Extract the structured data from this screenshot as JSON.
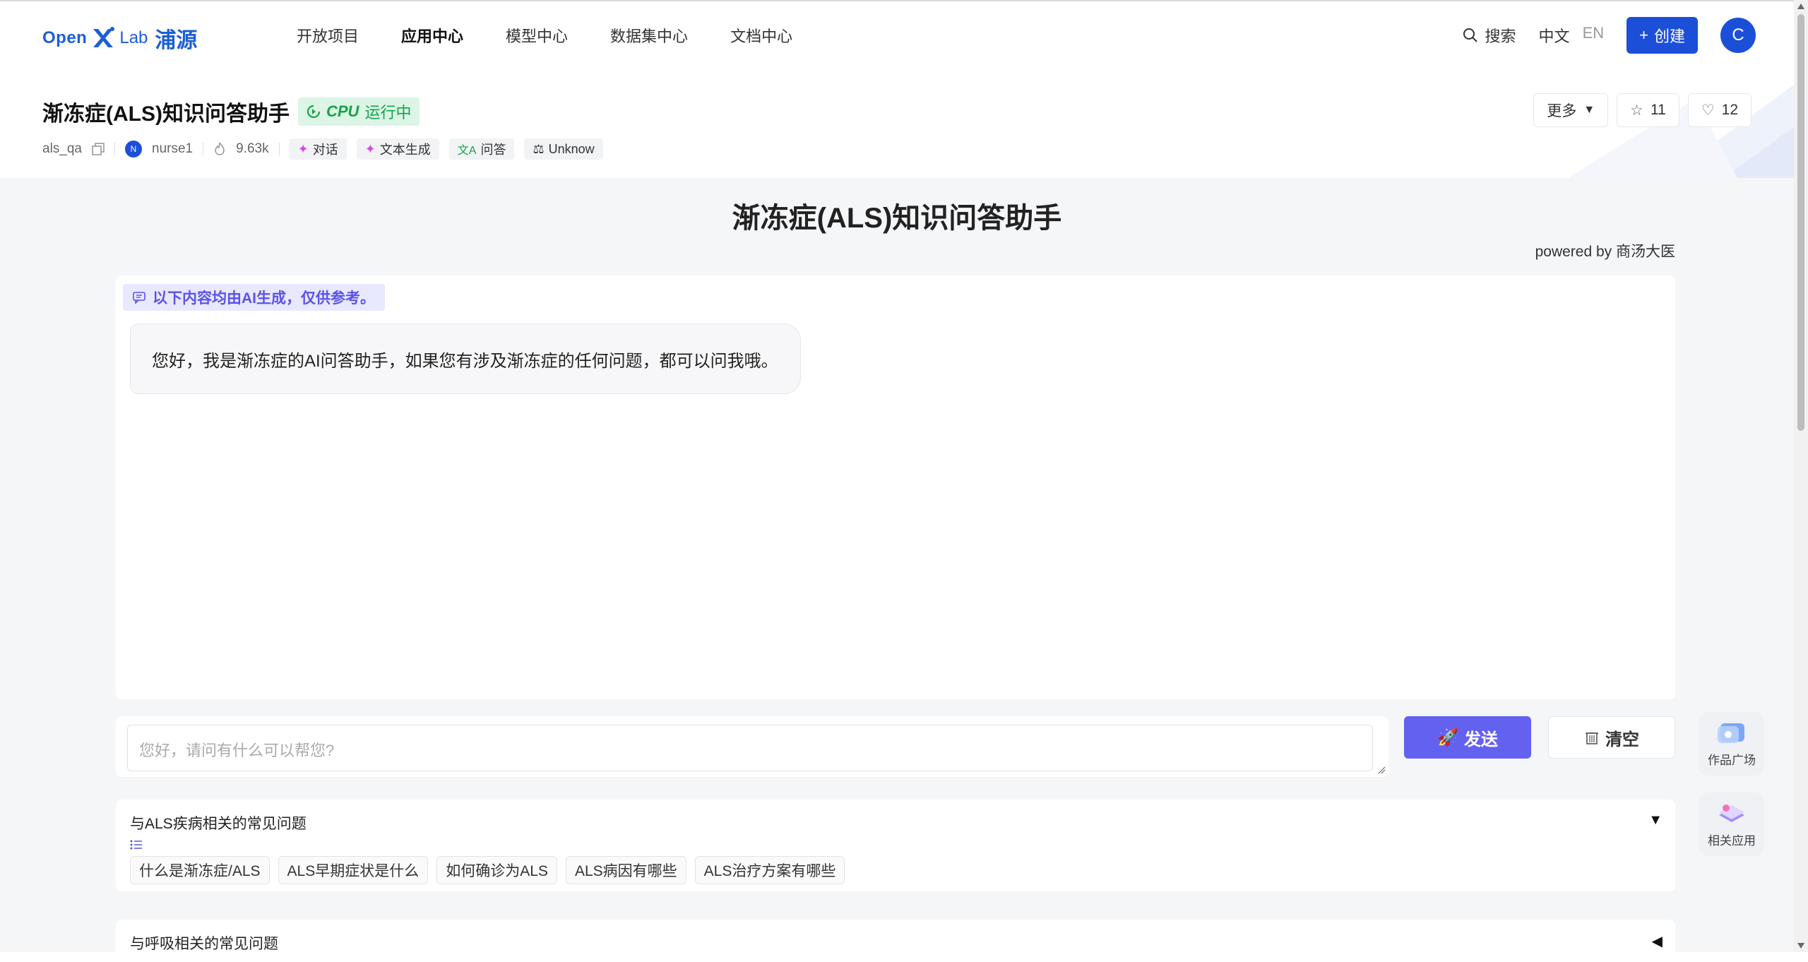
{
  "nav": {
    "logo": {
      "open": "Open",
      "lab": "Lab",
      "cn": "浦源"
    },
    "items": [
      "开放项目",
      "应用中心",
      "模型中心",
      "数据集中心",
      "文档中心"
    ],
    "active_index": 1,
    "search_label": "搜索",
    "lang_cn": "中文",
    "lang_en": "EN",
    "create_label": "创建",
    "avatar_letter": "C"
  },
  "app": {
    "title": "渐冻症(ALS)知识问答助手",
    "status_cpu": "CPU",
    "status_text": "运行中",
    "id": "als_qa",
    "owner_initial": "N",
    "owner": "nurse1",
    "views": "9.63k",
    "tags": [
      "对话",
      "文本生成",
      "问答",
      "Unknow"
    ],
    "more_label": "更多",
    "stars": "11",
    "likes": "12"
  },
  "main": {
    "page_title": "渐冻症(ALS)知识问答助手",
    "powered_by": "powered by 商汤大医",
    "ai_notice": "以下内容均由AI生成，仅供参考。",
    "greeting": "您好，我是渐冻症的AI问答助手，如果您有涉及渐冻症的任何问题，都可以问我哦。",
    "input_placeholder": "您好，请问有什么可以帮您?",
    "send_label": "发送",
    "clear_label": "清空"
  },
  "faq": [
    {
      "title": "与ALS疾病相关的常见问题",
      "expanded": true,
      "chips": [
        "什么是渐冻症/ALS",
        "ALS早期症状是什么",
        "如何确诊为ALS",
        "ALS病因有哪些",
        "ALS治疗方案有哪些"
      ]
    },
    {
      "title": "与呼吸相关的常见问题",
      "expanded": false,
      "chips": []
    }
  ],
  "side": {
    "gallery_label": "作品广场",
    "related_label": "相关应用"
  },
  "colors": {
    "brand": "#1c4fd8",
    "send": "#6361f0",
    "status_bg": "#dcf5e6",
    "status_fg": "#16a34a",
    "notice_fg": "#5b52e6"
  }
}
